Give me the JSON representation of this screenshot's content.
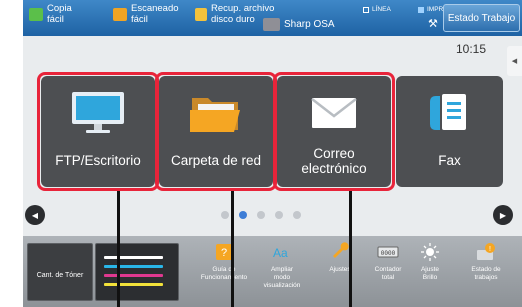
{
  "topbar": {
    "quick_copy": "Copia\nfácil",
    "quick_scan": "Escaneado\nfácil",
    "quick_recup": "Recup. archivo\ndisco duro",
    "quick_osa": "Sharp OSA",
    "status_line": "LÍNEA",
    "status_print": "IMPRES.",
    "job_status": "Estado Trabajo"
  },
  "clock": "10:15",
  "tiles": [
    {
      "label": "FTP/Escritorio",
      "icon": "monitor-icon"
    },
    {
      "label": "Carpeta de red",
      "icon": "folder-icon"
    },
    {
      "label": "Correo\nelectrónico",
      "icon": "envelope-icon"
    },
    {
      "label": "Fax",
      "icon": "fax-icon"
    }
  ],
  "carousel": {
    "pages": 5,
    "active": 2
  },
  "shelf": {
    "toner_label": "Cant. de Tóner",
    "items": [
      {
        "label": "Guía de\nFuncionamiento",
        "icon": "help-icon"
      },
      {
        "label": "Ampliar\nmodo\nvisualización",
        "icon": "magnify-text-icon"
      },
      {
        "label": "Ajustes",
        "icon": "wrench-icon"
      },
      {
        "label": "Contador\ntotal",
        "icon": "counter-icon"
      },
      {
        "label": "Ajuste\nBrillo",
        "icon": "brightness-icon"
      },
      {
        "label": "Estado de\ntrabajos",
        "icon": "job-status-icon"
      }
    ]
  },
  "colors": {
    "topbar": "#2a72b5",
    "tile": "#4d4f52",
    "highlight": "#e8243a",
    "dot_active": "#3d7dd6",
    "toner_black": "#ffffff",
    "toner_cyan": "#29b6e8",
    "toner_magenta": "#e0388f",
    "toner_yellow": "#f2e13a"
  }
}
